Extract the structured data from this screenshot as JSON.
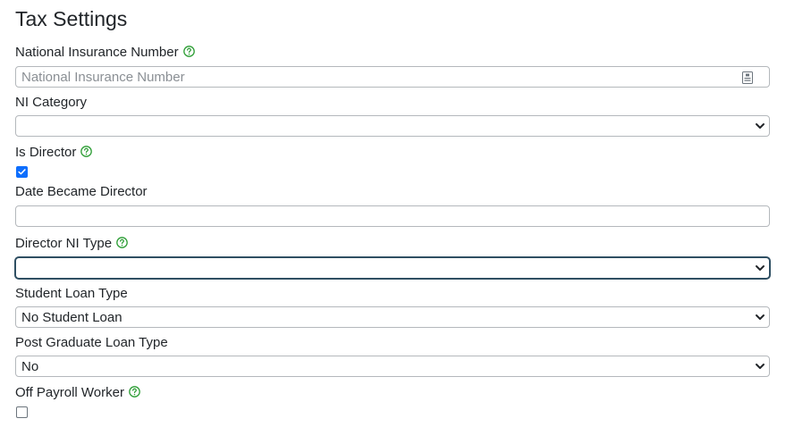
{
  "title": "Tax Settings",
  "fields": {
    "ni_number": {
      "label": "National Insurance Number",
      "placeholder": "National Insurance Number",
      "value": ""
    },
    "ni_category": {
      "label": "NI Category",
      "value": ""
    },
    "is_director": {
      "label": "Is Director",
      "checked": true
    },
    "date_became_director": {
      "label": "Date Became Director",
      "value": ""
    },
    "director_ni_type": {
      "label": "Director NI Type",
      "value": ""
    },
    "student_loan_type": {
      "label": "Student Loan Type",
      "value": "No Student Loan"
    },
    "post_graduate_loan_type": {
      "label": "Post Graduate Loan Type",
      "value": "No"
    },
    "off_payroll_worker": {
      "label": "Off Payroll Worker",
      "checked": false
    }
  },
  "icons": {
    "help": "help-circle-icon",
    "select": "chevron-down-icon",
    "autofill": "contact-card-icon"
  },
  "colors": {
    "help_icon": "#2e9e36",
    "checkbox_checked": "#0d6efd",
    "focus_border": "#2f4f63"
  }
}
